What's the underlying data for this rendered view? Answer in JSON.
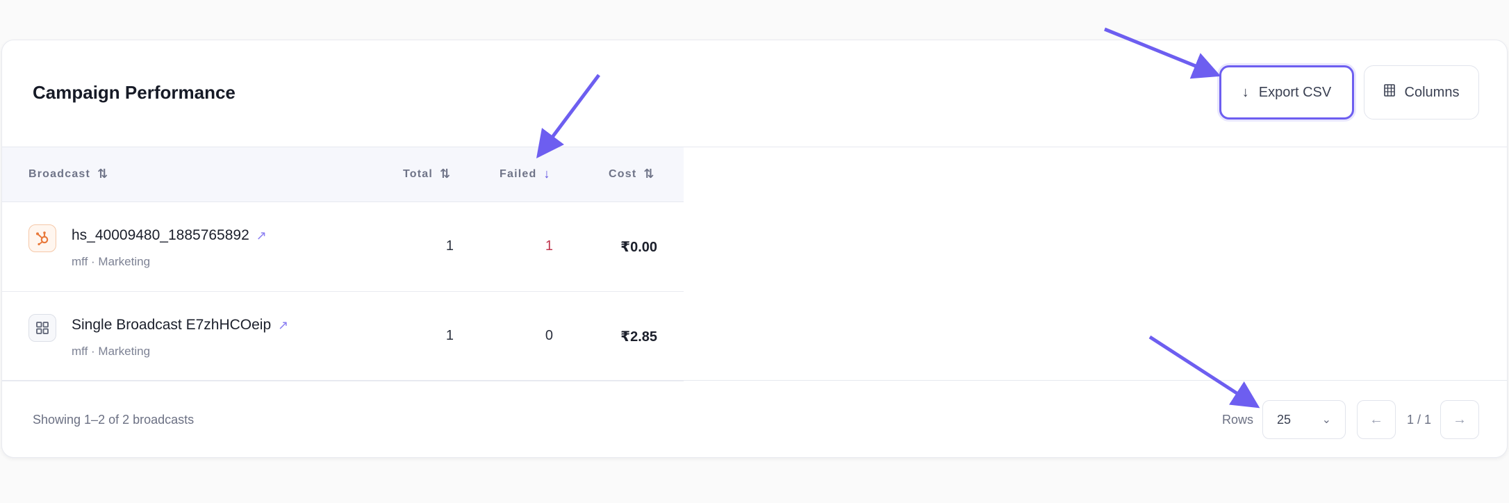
{
  "card": {
    "title": "Campaign Performance",
    "export_label": "Export CSV",
    "columns_label": "Columns"
  },
  "table": {
    "headers": [
      "Broadcast",
      "Total",
      "Failed",
      "Cost"
    ],
    "rows": [
      {
        "name": "hs_40009480_1885765892",
        "subtitle": "mff · Marketing",
        "total": "1",
        "failed": "1",
        "cost": "₹0.00",
        "icon": "hubspot-icon"
      },
      {
        "name": "Single Broadcast E7zhHCOeip",
        "subtitle": "mff · Marketing",
        "total": "1",
        "failed": "0",
        "cost": "₹2.85",
        "icon": "grid-icon"
      }
    ]
  },
  "footer": {
    "summary": "Showing 1–2 of 2 broadcasts",
    "rows_label": "Rows",
    "rows_value": "25",
    "page_indicator": "1 / 1"
  },
  "colors": {
    "accent": "#6d5ef0",
    "failed": "#c0354d",
    "hubspot": "#e8793b"
  }
}
